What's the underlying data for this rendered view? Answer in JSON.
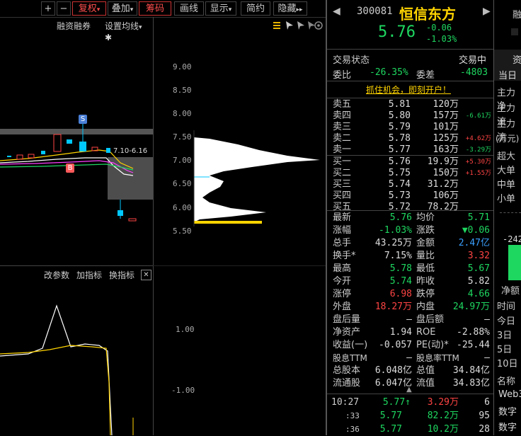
{
  "toolbar": {
    "plus": "+",
    "minus": "−",
    "fuquan": "复权",
    "diejia": "叠加",
    "chouma": "筹码",
    "huaxian": "画线",
    "xianshi": "显示",
    "jianyue": "简约",
    "yincang": "隐藏",
    "caret": "▾",
    "double_arrow": "▸▸"
  },
  "chart": {
    "rongzi": "融资融券",
    "shezhi": "设置均线",
    "range_label": "7.10-6.16",
    "marker_s": "S",
    "marker_b": "B",
    "price_ticks": [
      "9.00",
      "8.50",
      "8.00",
      "7.50",
      "7.00",
      "6.50",
      "6.00",
      "5.50"
    ],
    "indicator_ticks": [
      "1.00",
      "-1.00"
    ],
    "ind_gaicanshu": "改参数",
    "ind_jiazhibiao": "加指标",
    "ind_huanzhibiao": "换指标",
    "ind_close": "✕"
  },
  "stock": {
    "code": "300081",
    "name": "恒信东方",
    "price": "5.76",
    "change": "-0.06",
    "change_pct": "-1.03%",
    "status_label": "交易状态",
    "status_value": "交易中",
    "weibi_label": "委比",
    "weibi": "-26.35%",
    "weicha_label": "委差",
    "weicha": "-4803",
    "promo": "抓住机会，即刻开户！"
  },
  "sell_orders": [
    {
      "label": "卖五",
      "price": "5.81",
      "vol": "120万",
      "chg": ""
    },
    {
      "label": "卖四",
      "price": "5.80",
      "vol": "157万",
      "chg": "-6.61万"
    },
    {
      "label": "卖三",
      "price": "5.79",
      "vol": "101万",
      "chg": ""
    },
    {
      "label": "卖二",
      "price": "5.78",
      "vol": "125万",
      "chg": "+4.62万"
    },
    {
      "label": "卖一",
      "price": "5.77",
      "vol": "163万",
      "chg": "-3.29万"
    }
  ],
  "buy_orders": [
    {
      "label": "买一",
      "price": "5.76",
      "vol": "19.9万",
      "chg": "+5.30万"
    },
    {
      "label": "买二",
      "price": "5.75",
      "vol": "150万",
      "chg": "+1.55万"
    },
    {
      "label": "买三",
      "price": "5.74",
      "vol": "31.2万",
      "chg": ""
    },
    {
      "label": "买四",
      "price": "5.73",
      "vol": "106万",
      "chg": ""
    },
    {
      "label": "买五",
      "price": "5.72",
      "vol": "78.2万",
      "chg": ""
    }
  ],
  "quote": [
    {
      "l1": "最新",
      "v1": "5.76",
      "l2": "均价",
      "v2": "5.71"
    },
    {
      "l1": "涨幅",
      "v1": "-1.03%",
      "l2": "涨跌",
      "v2": "▼0.06"
    },
    {
      "l1": "总手",
      "v1": "43.25万",
      "l2": "金额",
      "v2": "2.47亿"
    },
    {
      "l1": "换手*",
      "v1": "7.15%",
      "l2": "量比",
      "v2": "3.32"
    },
    {
      "l1": "最高",
      "v1": "5.78",
      "l2": "最低",
      "v2": "5.67"
    },
    {
      "l1": "今开",
      "v1": "5.74",
      "l2": "昨收",
      "v2": "5.82"
    },
    {
      "l1": "涨停",
      "v1": "6.98",
      "l2": "跌停",
      "v2": "4.66"
    },
    {
      "l1": "外盘",
      "v1": "18.27万",
      "l2": "内盘",
      "v2": "24.97万"
    },
    {
      "l1": "盘后量",
      "v1": "—",
      "l2": "盘后额",
      "v2": "—"
    },
    {
      "l1": "净资产",
      "v1": "1.94",
      "l2": "ROE",
      "v2": "-2.88%"
    },
    {
      "l1": "收益(一)",
      "v1": "-0.057",
      "l2": "PE(动)*",
      "v2": "-25.44"
    },
    {
      "l1": "股息TTM",
      "v1": "—",
      "l2": "股息率TTM",
      "v2": "—"
    },
    {
      "l1": "总股本",
      "v1": "6.048亿",
      "l2": "总值",
      "v2": "34.84亿"
    },
    {
      "l1": "流通股",
      "v1": "6.047亿",
      "l2": "流值",
      "v2": "34.83亿"
    }
  ],
  "ticks": [
    {
      "time": "10:27",
      "price": "5.77↑",
      "vol": "3.29万",
      "n": "6"
    },
    {
      "time": ":33",
      "price": "5.77",
      "vol": "82.2万",
      "n": "95"
    },
    {
      "time": ":36",
      "price": "5.77",
      "vol": "10.2万",
      "n": "28"
    }
  ],
  "side": {
    "top": "融",
    "tab1": "资",
    "tab2": "当日",
    "rows": [
      "主力净",
      "主力流",
      "主力流",
      "(万元)",
      "超大",
      "大单",
      "中单",
      "小单"
    ],
    "bar_value": "-242",
    "jinge": "净额",
    "time_rows": [
      "时间",
      "今日",
      "3日",
      "5日",
      "10日"
    ],
    "name_label": "名称",
    "list": [
      "Web3",
      "数字",
      "数字"
    ]
  }
}
